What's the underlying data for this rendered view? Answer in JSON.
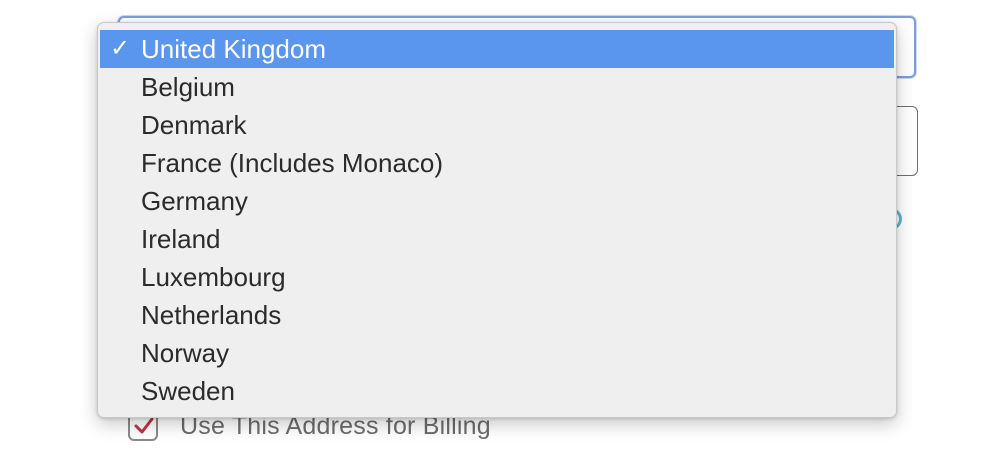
{
  "country_dropdown": {
    "selected_mark": "✓",
    "options": [
      {
        "label": "United Kingdom",
        "selected": true
      },
      {
        "label": "Belgium",
        "selected": false
      },
      {
        "label": "Denmark",
        "selected": false
      },
      {
        "label": "France (Includes Monaco)",
        "selected": false
      },
      {
        "label": "Germany",
        "selected": false
      },
      {
        "label": "Ireland",
        "selected": false
      },
      {
        "label": "Luxembourg",
        "selected": false
      },
      {
        "label": "Netherlands",
        "selected": false
      },
      {
        "label": "Norway",
        "selected": false
      },
      {
        "label": "Sweden",
        "selected": false
      }
    ],
    "highlight_color": "#5a95ee"
  },
  "billing": {
    "label": "Use This Address for Billing",
    "checked": true,
    "check_color": "#c0344a"
  },
  "icons": {
    "help": "help-circle-icon",
    "checkbox_check": "checkmark-icon"
  }
}
